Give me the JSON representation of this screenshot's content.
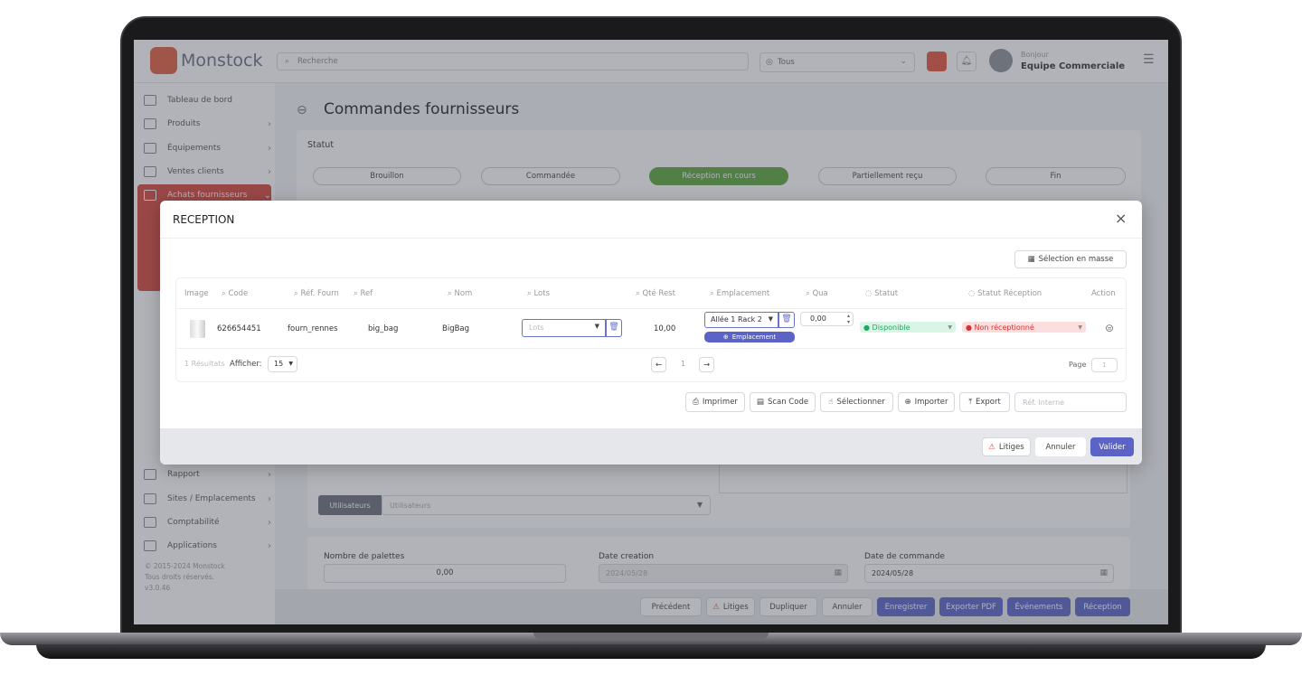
{
  "app": {
    "brand": "Monstock",
    "search_placeholder": "Recherche",
    "site_select": "Tous",
    "greeting": "Bonjour",
    "user_name": "Equipe Commerciale"
  },
  "sidebar": {
    "items": [
      {
        "label": "Tableau de bord",
        "icon": "grid-icon"
      },
      {
        "label": "Produits",
        "icon": "box-icon"
      },
      {
        "label": "Équipements",
        "icon": "tool-icon"
      },
      {
        "label": "Ventes clients",
        "icon": "store-icon"
      },
      {
        "label": "Achats fournisseurs",
        "icon": "truck-icon",
        "active": true
      },
      {
        "label": "Rapport",
        "icon": "chart-icon"
      },
      {
        "label": "Sites / Emplacements",
        "icon": "building-icon"
      },
      {
        "label": "Comptabilité",
        "icon": "calculator-icon"
      },
      {
        "label": "Applications",
        "icon": "clipboard-icon"
      }
    ],
    "footer": [
      "© 2015-2024 Monstock",
      "Tous droits réservés.",
      "v3.0.46"
    ]
  },
  "page": {
    "title": "Commandes fournisseurs",
    "status_label": "Statut",
    "steps": [
      {
        "label": "Brouillon"
      },
      {
        "label": "Commandée"
      },
      {
        "label": "Réception en cours",
        "active": true
      },
      {
        "label": "Partiellement reçu"
      },
      {
        "label": "Fin"
      }
    ],
    "users_tag": "Utilisateurs",
    "users_placeholder": "Utilisateurs",
    "pallets_label": "Nombre de palettes",
    "pallets_value": "0,00",
    "date_creation_label": "Date creation",
    "date_creation_value": "2024/05/28",
    "date_order_label": "Date de commande",
    "date_order_value": "2024/05/28",
    "actions": [
      "Précédent",
      "Litiges",
      "Dupliquer",
      "Annuler",
      "Enregistrer",
      "Exporter PDF",
      "Événements",
      "Réception"
    ]
  },
  "modal": {
    "title": "RECEPTION",
    "bulk_select": "Sélection en masse",
    "columns": [
      "Image",
      "Code",
      "Réf. Fourn",
      "Ref",
      "Nom",
      "Lots",
      "Qté Rest",
      "Emplacement",
      "Qua",
      "Statut",
      "Statut Réception",
      "Action"
    ],
    "row": {
      "code": "626654451",
      "ref_fourn": "fourn_rennes",
      "ref": "big_bag",
      "nom": "BigBag",
      "lots_placeholder": "Lots",
      "qte_rest": "10,00",
      "emplacement": "Allée 1 Rack 2",
      "emplacement_button": "Emplacement",
      "qua": "0,00",
      "statut": "Disponible",
      "statut_reception": "Non réceptionné"
    },
    "results": "1 Résultats",
    "show_label": "Afficher:",
    "show_value": "15",
    "page_num": "1",
    "page_label": "Page",
    "page_input": "1",
    "tools": [
      "Imprimer",
      "Scan Code",
      "Sélectionner",
      "Importer",
      "Export"
    ],
    "ref_interne_placeholder": "Réf. Interne",
    "footer": {
      "litiges": "Litiges",
      "cancel": "Annuler",
      "validate": "Valider"
    }
  },
  "colors": {
    "accent": "#5b63c6",
    "brand": "#e0483e",
    "active_step": "#5aa53c",
    "available": "#2ec27e",
    "not_received": "#e03b3b"
  }
}
